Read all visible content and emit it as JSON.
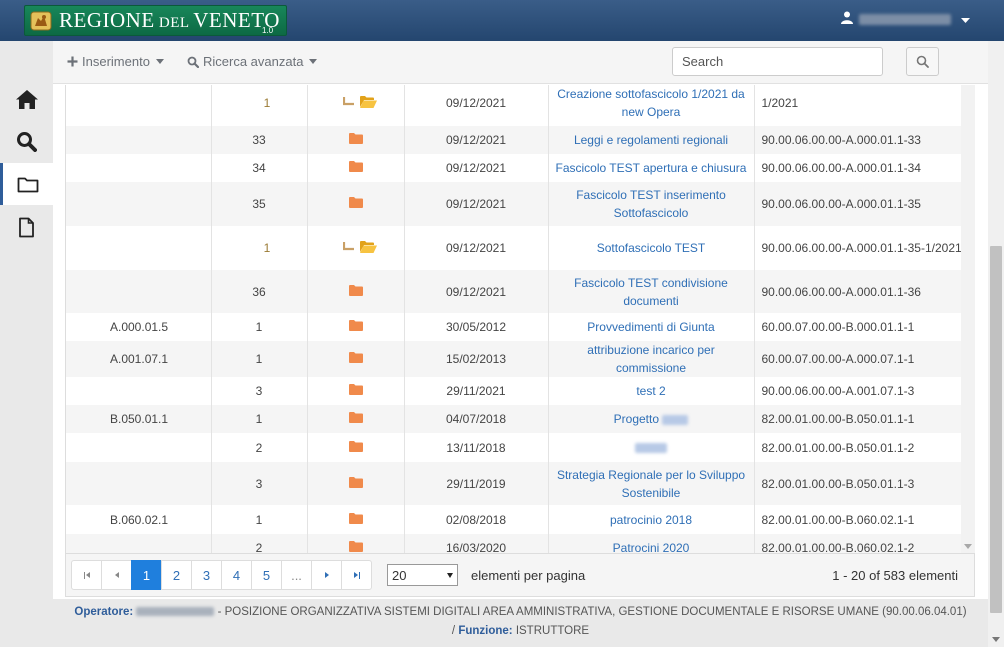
{
  "header": {
    "brand_main": "REGIONE",
    "brand_small": " DEL ",
    "brand_end": "VENETO",
    "version": "1.0",
    "user_icon": "user-icon"
  },
  "sidebar": {
    "items": [
      {
        "name": "home",
        "icon": "home-icon"
      },
      {
        "name": "search",
        "icon": "search-icon"
      },
      {
        "name": "folder",
        "icon": "folder-icon",
        "active": true
      },
      {
        "name": "document",
        "icon": "document-icon"
      }
    ]
  },
  "toolbar": {
    "insert_label": "Inserimento",
    "advanced_search_label": "Ricerca avanzata",
    "search_placeholder": "Search"
  },
  "table": {
    "rows": [
      {
        "class": "",
        "num": "1",
        "sub": true,
        "date": "09/12/2021",
        "title": "Creazione sottofascicolo 1/2021 da new Opera",
        "code": "1/2021",
        "alt": false
      },
      {
        "class": "",
        "num": "33",
        "sub": false,
        "date": "09/12/2021",
        "title": "Leggi e regolamenti regionali",
        "code": "90.00.06.00.00-A.000.01.1-33",
        "alt": true
      },
      {
        "class": "",
        "num": "34",
        "sub": false,
        "date": "09/12/2021",
        "title": "Fascicolo TEST apertura e chiusura",
        "code": "90.00.06.00.00-A.000.01.1-34",
        "alt": false
      },
      {
        "class": "",
        "num": "35",
        "sub": false,
        "date": "09/12/2021",
        "title": "Fascicolo TEST inserimento Sottofascicolo",
        "code": "90.00.06.00.00-A.000.01.1-35",
        "alt": true
      },
      {
        "class": "",
        "num": "1",
        "sub": true,
        "date": "09/12/2021",
        "title": "Sottofascicolo TEST",
        "code": "90.00.06.00.00-A.000.01.1-35-1/2021",
        "alt": false
      },
      {
        "class": "",
        "num": "36",
        "sub": false,
        "date": "09/12/2021",
        "title": "Fascicolo TEST condivisione documenti",
        "code": "90.00.06.00.00-A.000.01.1-36",
        "alt": true
      },
      {
        "class": "A.000.01.5",
        "num": "1",
        "sub": false,
        "date": "30/05/2012",
        "title": "Provvedimenti di Giunta",
        "code": "60.00.07.00.00-B.000.01.1-1",
        "alt": false
      },
      {
        "class": "A.001.07.1",
        "num": "1",
        "sub": false,
        "date": "15/02/2013",
        "title": "attribuzione incarico per commissione",
        "code": "60.00.07.00.00-A.000.07.1-1",
        "alt": true
      },
      {
        "class": "",
        "num": "3",
        "sub": false,
        "date": "29/11/2021",
        "title": "test 2",
        "code": "90.00.06.00.00-A.001.07.1-3",
        "alt": false
      },
      {
        "class": "B.050.01.1",
        "num": "1",
        "sub": false,
        "date": "04/07/2018",
        "title": "Progetto",
        "code": "82.00.01.00.00-B.050.01.1-1",
        "alt": true
      },
      {
        "class": "",
        "num": "2",
        "sub": false,
        "date": "13/11/2018",
        "title": "",
        "code": "82.00.01.00.00-B.050.01.1-2",
        "alt": false
      },
      {
        "class": "",
        "num": "3",
        "sub": false,
        "date": "29/11/2019",
        "title": "Strategia Regionale per lo Sviluppo Sostenibile",
        "code": "82.00.01.00.00-B.050.01.1-3",
        "alt": true
      },
      {
        "class": "B.060.02.1",
        "num": "1",
        "sub": false,
        "date": "02/08/2018",
        "title": "patrocinio 2018",
        "code": "82.00.01.00.00-B.060.02.1-1",
        "alt": false
      },
      {
        "class": "",
        "num": "2",
        "sub": false,
        "date": "16/03/2020",
        "title": "Patrocini 2020",
        "code": "82.00.01.00.00-B.060.02.1-2",
        "alt": true
      }
    ]
  },
  "pager": {
    "pages": [
      "1",
      "2",
      "3",
      "4",
      "5",
      "..."
    ],
    "active": "1",
    "per_page": "20",
    "per_page_label": "elementi per pagina",
    "count": "1 - 20 of 583 elementi"
  },
  "footer": {
    "operator_label": "Operatore:",
    "operator_desc": " - POSIZIONE ORGANIZZATIVA SISTEMI DIGITALI AREA AMMINISTRATIVA, GESTIONE DOCUMENTALE E RISORSE UMANE (90.00.06.04.01)",
    "sep": "/",
    "role_label": "Funzione:",
    "role_value": "ISTRUTTORE"
  },
  "colors": {
    "header": "#2a4b76",
    "brand_green": "#12784f",
    "folder": "#f08a4b",
    "subfolder": "#f2b21f",
    "link": "#2f6fb6",
    "active_page": "#1f7fdd"
  }
}
